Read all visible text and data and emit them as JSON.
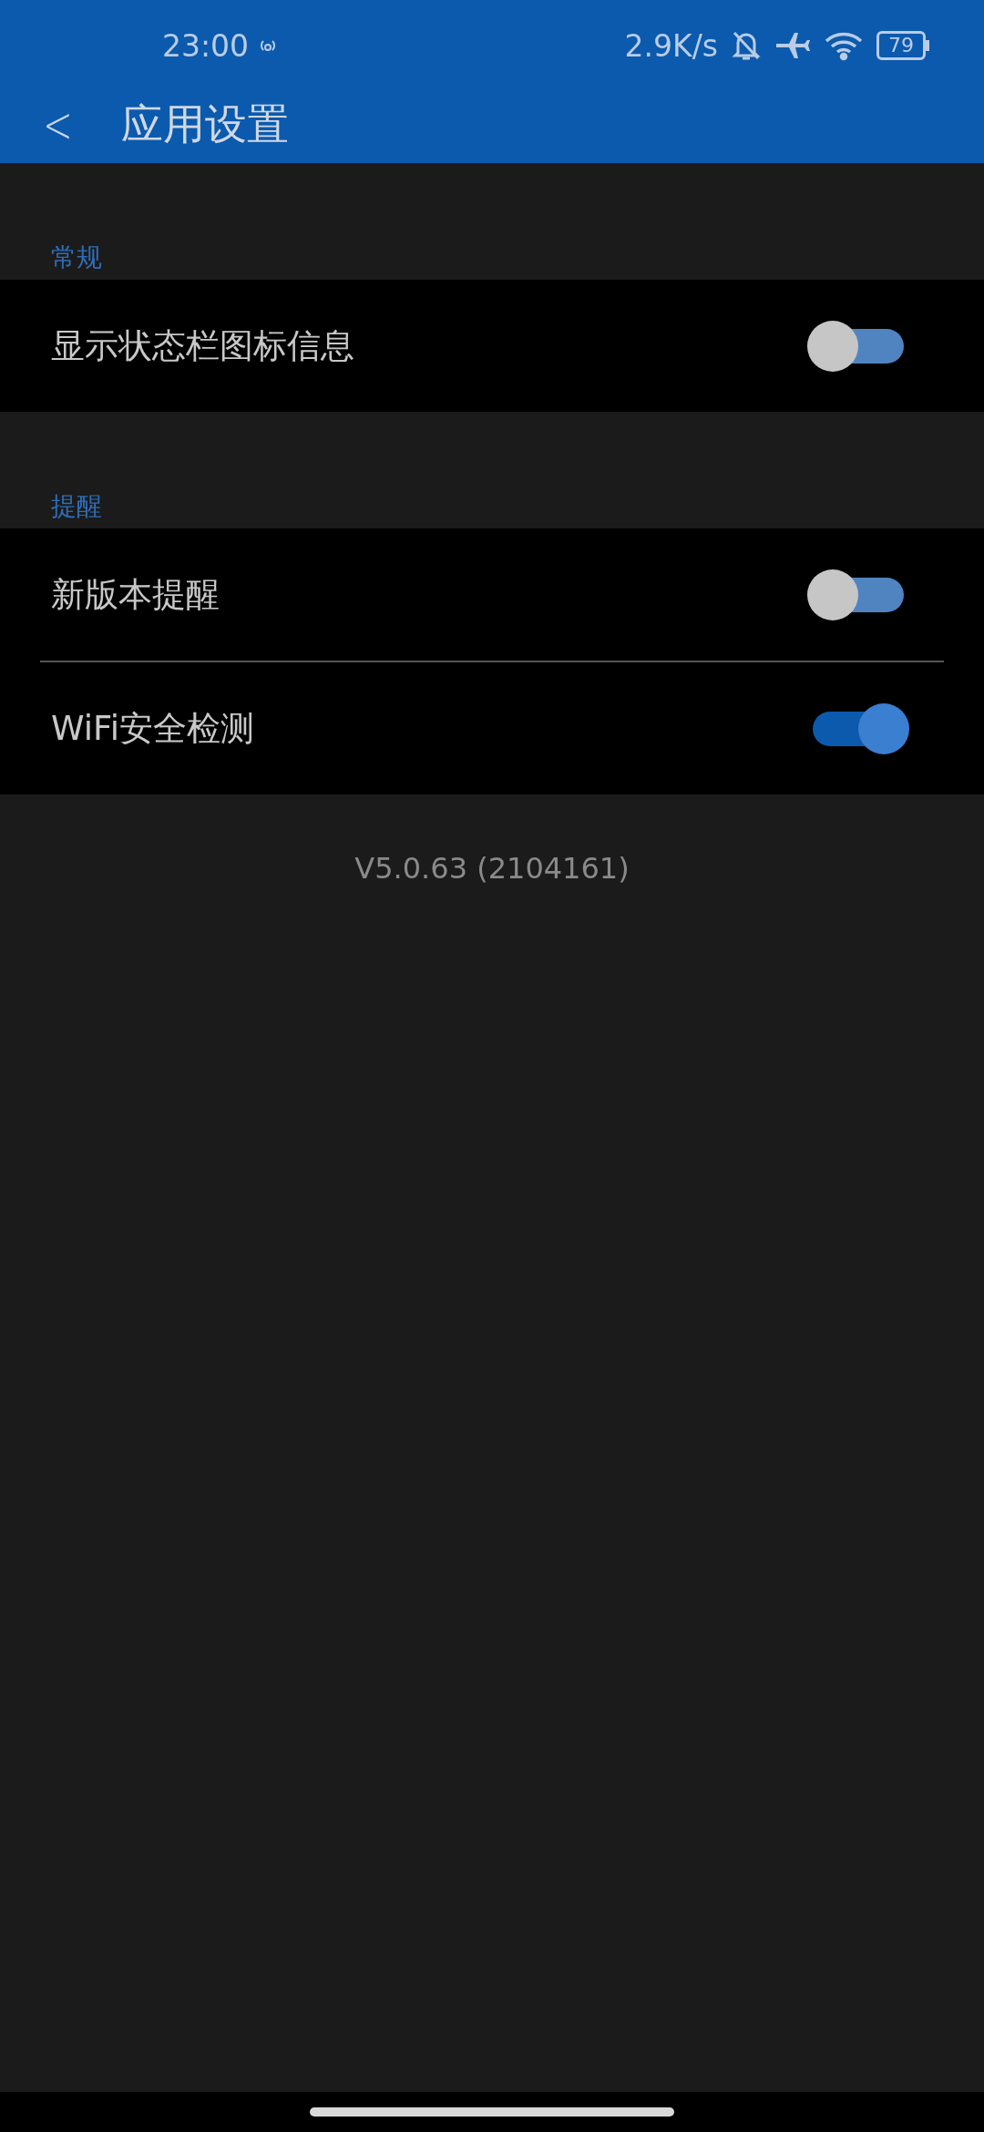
{
  "status_bar": {
    "time": "23:00",
    "speed": "2.9K/s",
    "battery": "79"
  },
  "header": {
    "back": "<",
    "title": "应用设置"
  },
  "sections": [
    {
      "title": "常规",
      "items": [
        {
          "label": "显示状态栏图标信息",
          "on": false
        }
      ]
    },
    {
      "title": "提醒",
      "items": [
        {
          "label": "新版本提醒",
          "on": false
        },
        {
          "label": "WiFi安全检测",
          "on": true
        }
      ]
    }
  ],
  "version": "V5.0.63 (2104161)"
}
